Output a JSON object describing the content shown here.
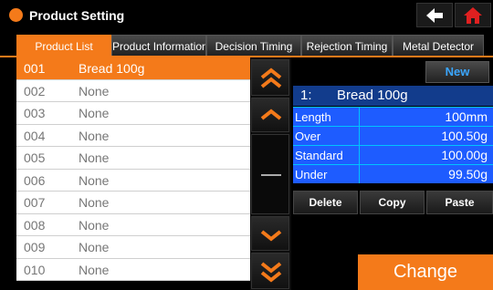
{
  "header": {
    "title": "Product Setting"
  },
  "tabs": [
    {
      "label": "Product List"
    },
    {
      "label": "Product Information"
    },
    {
      "label": "Decision Timing"
    },
    {
      "label": "Rejection Timing"
    },
    {
      "label": "Metal Detector"
    }
  ],
  "products": [
    {
      "num": "001",
      "name": "Bread 100g"
    },
    {
      "num": "002",
      "name": "None"
    },
    {
      "num": "003",
      "name": "None"
    },
    {
      "num": "004",
      "name": "None"
    },
    {
      "num": "005",
      "name": "None"
    },
    {
      "num": "006",
      "name": "None"
    },
    {
      "num": "007",
      "name": "None"
    },
    {
      "num": "008",
      "name": "None"
    },
    {
      "num": "009",
      "name": "None"
    },
    {
      "num": "010",
      "name": "None"
    }
  ],
  "panel": {
    "new_label": "New",
    "selected_num": "1:",
    "selected_name": "Bread 100g",
    "fields": [
      {
        "label": "Length",
        "value": "100mm"
      },
      {
        "label": "Over",
        "value": "100.50g"
      },
      {
        "label": "Standard",
        "value": "100.00g"
      },
      {
        "label": "Under",
        "value": "99.50g"
      }
    ],
    "delete_label": "Delete",
    "copy_label": "Copy",
    "paste_label": "Paste",
    "change_label": "Change"
  },
  "colors": {
    "accent": "#f47a1a",
    "field_bg": "#1e5cff",
    "head_bg": "#123c8c",
    "home": "#e02020"
  }
}
